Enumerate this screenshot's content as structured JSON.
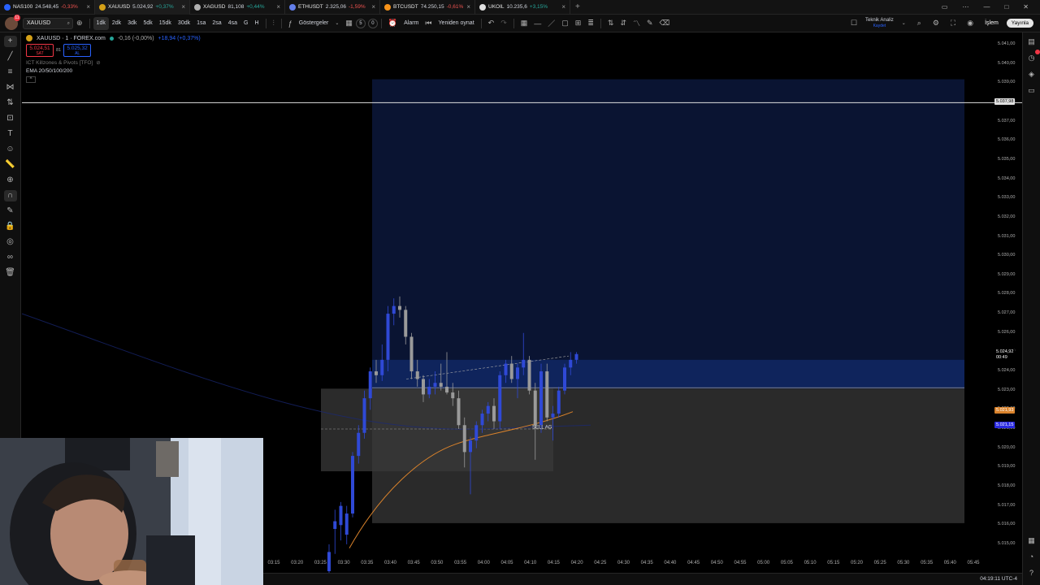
{
  "tabs": [
    {
      "symbol": "NAS100",
      "price": "24.548,45",
      "change": "-0,33%",
      "dir": "down",
      "icon_color": "#2962ff",
      "active": false
    },
    {
      "symbol": "XAUUSD",
      "price": "5.024,92",
      "change": "+0,37%",
      "dir": "up",
      "icon_color": "#d4a017",
      "active": true
    },
    {
      "symbol": "XAGUSD",
      "price": "81,108",
      "change": "+0,44%",
      "dir": "up",
      "icon_color": "#b0b0b0",
      "active": false
    },
    {
      "symbol": "ETHUSDT",
      "price": "2.325,06",
      "change": "-1,59%",
      "dir": "down",
      "icon_color": "#627eea",
      "active": false
    },
    {
      "symbol": "BTCUSDT",
      "price": "74.250,15",
      "change": "-0,61%",
      "dir": "down",
      "icon_color": "#f7931a",
      "active": false
    },
    {
      "symbol": "UKOIL",
      "price": "10.235,6",
      "change": "+3,15%",
      "dir": "up",
      "icon_color": "#e0e0e0",
      "active": false
    }
  ],
  "toolbar": {
    "symbol": "XAUUSD",
    "timeframes": [
      "1dk",
      "2dk",
      "3dk",
      "5dk",
      "15dk",
      "30dk",
      "1sa",
      "2sa",
      "4sa",
      "G",
      "H"
    ],
    "active_timeframe": "1dk",
    "indicators_label": "Göstergeler",
    "counter_1": "5",
    "counter_2": "0",
    "alarm_label": "Alarm",
    "replay_label": "Yeniden oynat",
    "ta_label": "Teknik Analiz",
    "ta_sub": "Kaydet",
    "trade_label": "İşlem",
    "publish_label": "Yayınla"
  },
  "legend": {
    "title": "XAUUSD · 1 · FOREX.com",
    "change_abs": "-0,16 (-0,00%)",
    "change_ext": "+18,94 (+0,37%)",
    "sell_price": "5.024,51",
    "sell_label": "SAT",
    "spread": "81",
    "buy_price": "5.025,32",
    "buy_label": "AL",
    "indicator_1": "ICT Killzones & Pivots [TFO]",
    "indicator_2": "EMA 20/50/100/200"
  },
  "price_axis": [
    "5.041,00",
    "5.040,00",
    "5.039,00",
    "5.038,00",
    "5.037,00",
    "5.036,00",
    "5.035,00",
    "5.034,00",
    "5.033,00",
    "5.032,00",
    "5.031,00",
    "5.030,00",
    "5.029,00",
    "5.028,00",
    "5.027,00",
    "5.026,00",
    "5.025,00",
    "5.024,00",
    "5.023,00",
    "5.022,00",
    "5.021,00",
    "5.020,00",
    "5.019,00",
    "5.018,00",
    "5.017,00",
    "5.016,00",
    "5.015,00"
  ],
  "price_labels": {
    "hline": "5.037,98",
    "last": "5.024,92",
    "countdown": "00:49",
    "orange": "5.021,93",
    "blue": "5.021,15"
  },
  "time_axis": [
    "03:15",
    "03:20",
    "03:25",
    "03:30",
    "03:35",
    "03:40",
    "03:45",
    "03:50",
    "03:55",
    "04:00",
    "04:05",
    "04:10",
    "04:15",
    "04:20",
    "04:25",
    "04:30",
    "04:35",
    "04:40",
    "04:45",
    "04:50",
    "04:55",
    "05:00",
    "05:05",
    "05:10",
    "05:15",
    "05:20",
    "05:25",
    "05:30",
    "05:35",
    "05:40",
    "05:45"
  ],
  "chart_label": "SELL AG",
  "clock": "04:19:11 UTC-4",
  "colors": {
    "bull": "#2f49d6",
    "bear": "#9a9a9a",
    "tp_zone": "#0a1432",
    "entry_zone": "#102660",
    "sl_zone": "#2a2a2a",
    "session_box": "#3a3a3a",
    "ema_orange": "#d9822b"
  }
}
